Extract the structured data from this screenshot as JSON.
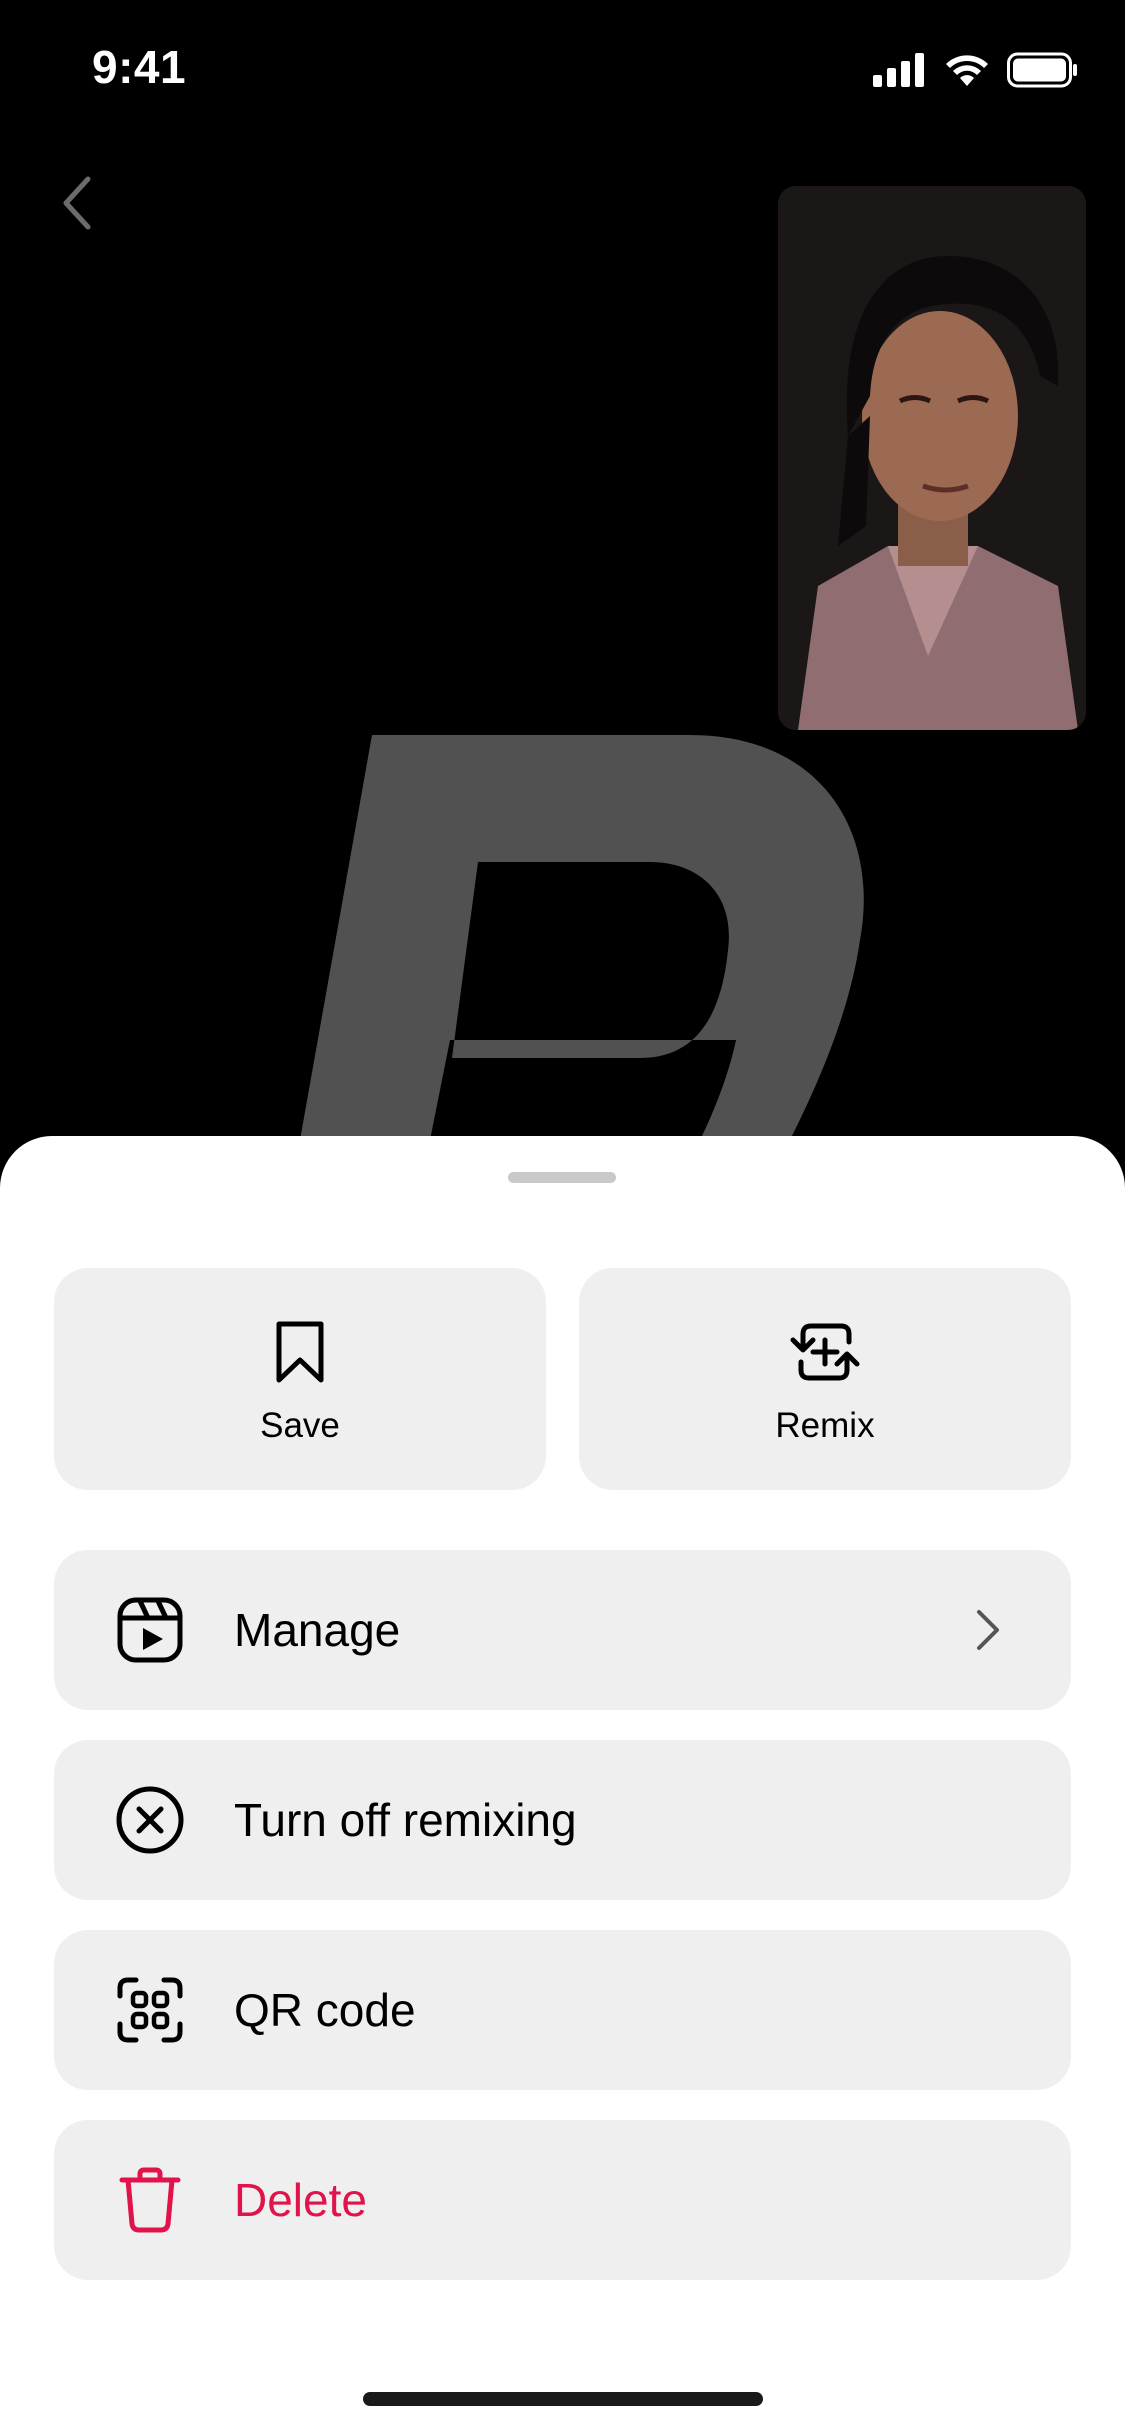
{
  "status_bar": {
    "time": "9:41"
  },
  "sheet": {
    "tiles": [
      {
        "label": "Save",
        "icon": "bookmark-icon"
      },
      {
        "label": "Remix",
        "icon": "remix-icon"
      }
    ],
    "rows": [
      {
        "label": "Manage",
        "icon": "reel-icon",
        "has_chevron": true
      },
      {
        "label": "Turn off remixing",
        "icon": "circle-x-icon"
      },
      {
        "label": "QR code",
        "icon": "qr-code-icon"
      },
      {
        "label": "Delete",
        "icon": "trash-icon",
        "color": "#e0134b"
      }
    ]
  },
  "colors": {
    "sheet_background": "#ffffff",
    "tile_background": "#efefef",
    "danger": "#e0134b"
  }
}
